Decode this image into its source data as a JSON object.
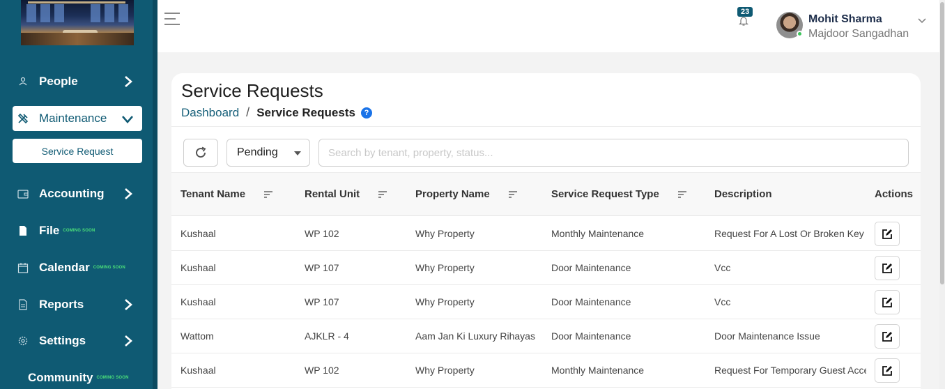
{
  "sidebar": {
    "items": [
      {
        "label": "People",
        "icon": "person-icon"
      },
      {
        "label": "Maintenance",
        "icon": "tools-icon"
      },
      {
        "label": "Service Request"
      },
      {
        "label": "Accounting",
        "icon": "wallet-icon"
      },
      {
        "label": "File",
        "icon": "file-icon",
        "soon": "COMING SOON"
      },
      {
        "label": "Calendar",
        "icon": "calendar-icon",
        "soon": "COMING SOON"
      },
      {
        "label": "Reports",
        "icon": "report-icon"
      },
      {
        "label": "Settings",
        "icon": "gear-icon"
      },
      {
        "label": "Community",
        "soon": "COMING SOON"
      }
    ]
  },
  "topbar": {
    "notification_count": "23",
    "user_name": "Mohit Sharma",
    "user_org": "Majdoor Sangadhan"
  },
  "page": {
    "title": "Service Requests",
    "breadcrumb": {
      "home": "Dashboard",
      "separator": "/",
      "current": "Service Requests",
      "help": "?"
    }
  },
  "filters": {
    "status_selected": "Pending",
    "search_placeholder": "Search by tenant, property, status..."
  },
  "table": {
    "columns": [
      "Tenant Name",
      "Rental Unit",
      "Property Name",
      "Service Request Type",
      "Description",
      "Actions"
    ],
    "rows": [
      [
        "Kushaal",
        "WP 102",
        "Why Property",
        "Monthly Maintenance",
        "Request For A Lost Or Broken Key"
      ],
      [
        "Kushaal",
        "WP 107",
        "Why Property",
        "Door Maintenance",
        "Vcc"
      ],
      [
        "Kushaal",
        "WP 107",
        "Why Property",
        "Door Maintenance",
        "Vcc"
      ],
      [
        "Wattom",
        "AJKLR - 4",
        "Aam Jan Ki Luxury Rihayas",
        "Door Maintenance",
        "Door Maintenance Issue"
      ],
      [
        "Kushaal",
        "WP 102",
        "Why Property",
        "Monthly Maintenance",
        "Request For Temporary Guest Access"
      ]
    ]
  },
  "colors": {
    "brand": "#0f5a73",
    "accent_help": "#1a73e8",
    "coming_soon": "#4be07a",
    "online": "#3bc45a"
  }
}
